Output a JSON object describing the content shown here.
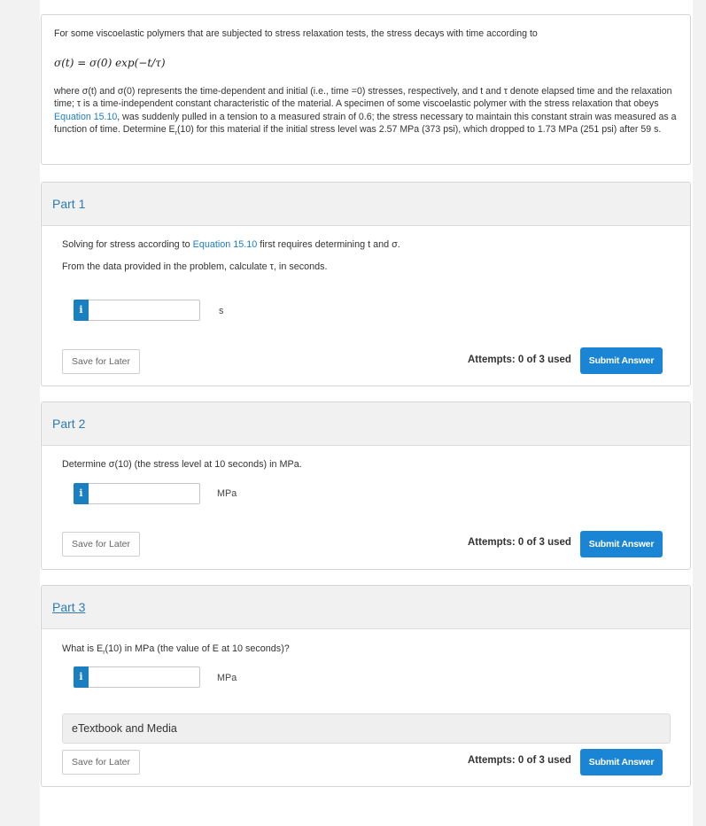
{
  "problem": {
    "intro": "For some viscoelastic polymers that are subjected to stress relaxation tests, the stress decays with time according to",
    "equation": "σ(t) = σ(0) exp(−t/τ)",
    "body_pre": "where σ(t) and σ(0) represents the time-dependent and initial (i.e., time =0) stresses, respectively, and t and τ denote elapsed time and the relaxation time; τ is a time-independent constant characteristic of the material. A specimen of some viscoelastic polymer with the stress relaxation that obeys ",
    "body_link": "Equation 15.10",
    "body_post": ", was suddenly pulled in a tension to a measured strain of 0.6; the stress necessary to maintain this constant strain was measured as a function of time. Determine E",
    "body_sub": "r",
    "body_end": "(10) for this material if the initial stress level was 2.57 MPa (373 psi), which dropped to 1.73 MPa (251 psi) after 59 s."
  },
  "parts": [
    {
      "title": "Part 1",
      "line1_pre": "Solving for stress according to ",
      "line1_link": "Equation 15.10",
      "line1_post": " first requires determining t and σ.",
      "line2": "From the data provided in the problem, calculate τ, in seconds.",
      "info_icon": "i",
      "input_value": "",
      "unit": "s",
      "save_label": "Save for Later",
      "attempts": "Attempts: 0 of 3 used",
      "submit_label": "Submit Answer"
    },
    {
      "title": "Part 2",
      "question": "Determine σ(10) (the stress level at 10 seconds) in MPa.",
      "info_icon": "i",
      "input_value": "",
      "unit": "MPa",
      "save_label": "Save for Later",
      "attempts": "Attempts: 0 of 3 used",
      "submit_label": "Submit Answer"
    },
    {
      "title": "Part 3",
      "question_pre": "What is E",
      "question_sub": "r",
      "question_post": "(10) in MPa (the value of E at 10 seconds)?",
      "info_icon": "i",
      "input_value": "",
      "unit": "MPa",
      "etextbook_label": "eTextbook and Media",
      "save_label": "Save for Later",
      "attempts": "Attempts: 0 of 3 used",
      "submit_label": "Submit Answer"
    }
  ],
  "colors": {
    "accent": "#1a85d4",
    "link": "#1a7fc1",
    "header_bg": "#f1f1f1"
  }
}
